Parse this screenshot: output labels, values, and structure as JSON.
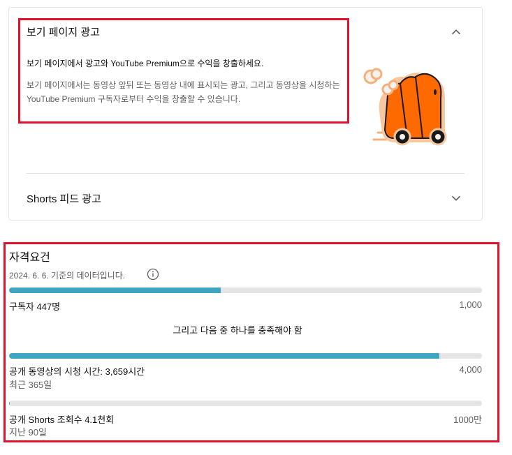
{
  "ads_card": {
    "watch_page": {
      "title": "보기 페이지 광고",
      "subtitle": "보기 페이지에서 광고와 YouTube Premium으로 수익을 창출하세요.",
      "description": "보기 페이지에서는 동영상 앞뒤 또는 동영상 내에 표시되는 광고, 그리고 동영상을 시청하는 YouTube Premium 구독자로부터 수익을 창출할 수 있습니다.",
      "expand_icon": "chevron-up-icon"
    },
    "shorts_feed": {
      "title": "Shorts 피드 광고",
      "expand_icon": "chevron-down-icon"
    },
    "illustration": "orange-money-truck-illustration"
  },
  "eligibility": {
    "title": "자격요건",
    "data_date": "2024. 6. 6. 기준의 데이터입니다.",
    "info_icon": "info-icon",
    "accent_color": "#3ea6c3",
    "track_color": "#e5e5e5",
    "subscribers": {
      "label": "구독자 447명",
      "target": "1,000",
      "progress": 0.447
    },
    "condition_text": "그리고 다음 중 하나를 충족해야 함",
    "watch_hours": {
      "label": "공개 동영상의 시청 시간: 3,659시간",
      "period": "최근 365일",
      "target": "4,000",
      "progress": 0.91
    },
    "shorts_views": {
      "label": "공개 Shorts 조회수 4.1천회",
      "period": "지난 90일",
      "target": "1000만",
      "progress": 0.0004
    }
  }
}
